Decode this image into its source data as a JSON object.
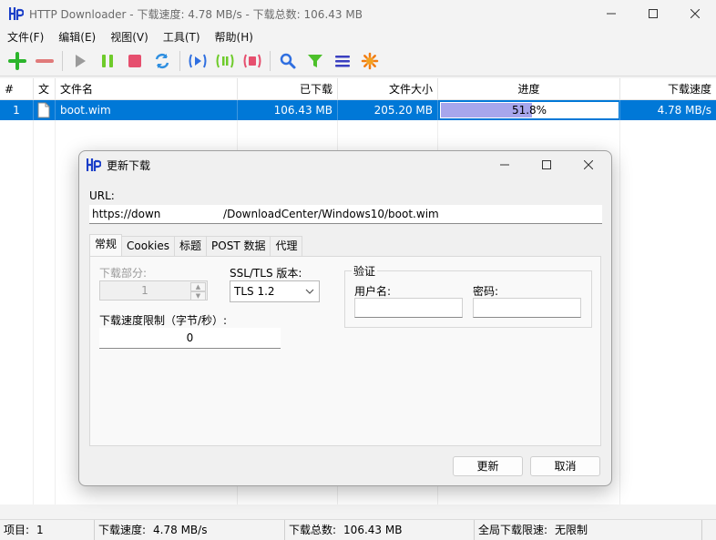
{
  "window": {
    "title": "HTTP Downloader - 下载速度:  4.78 MB/s - 下载总数:  106.43 MB"
  },
  "menu": [
    "文件(F)",
    "编辑(E)",
    "视图(V)",
    "工具(T)",
    "帮助(H)"
  ],
  "toolbar": {
    "buttons": [
      "add-icon",
      "remove-icon",
      "start-icon",
      "pause-icon",
      "stop-icon",
      "restart-icon",
      "start-all-icon",
      "pause-all-icon",
      "stop-all-icon",
      "search-icon",
      "filter-icon",
      "list-icon",
      "options-icon"
    ]
  },
  "list": {
    "columns": [
      "#",
      "文",
      "文件名",
      "已下载",
      "文件大小",
      "进度",
      "下载速度"
    ],
    "rows": [
      {
        "index": "1",
        "filename": "boot.wim",
        "downloaded": "106.43 MB",
        "size": "205.20 MB",
        "progress_text": "51.8%",
        "progress": 0.518,
        "speed": "4.78 MB/s"
      }
    ]
  },
  "status": {
    "items_label": "项目:",
    "items_value": "1",
    "speed_label": "下载速度:",
    "speed_value": "4.78 MB/s",
    "total_label": "下载总数:",
    "total_value": "106.43 MB",
    "limit_label": "全局下载限速:",
    "limit_value": "无限制"
  },
  "dialog": {
    "title": "更新下载",
    "url_label": "URL:",
    "url_value": "https://down                  /DownloadCenter/Windows10/boot.wim",
    "tabs": [
      "常规",
      "Cookies",
      "标题",
      "POST 数据",
      "代理"
    ],
    "segments_label": "下载部分:",
    "segments_value": "1",
    "ssl_label": "SSL/TLS 版本:",
    "ssl_value": "TLS 1.2",
    "speed_limit_label": "下载速度限制（字节/秒）:",
    "speed_limit_value": "0",
    "auth_title": "验证",
    "username_label": "用户名:",
    "password_label": "密码:",
    "update_button": "更新",
    "cancel_button": "取消"
  }
}
